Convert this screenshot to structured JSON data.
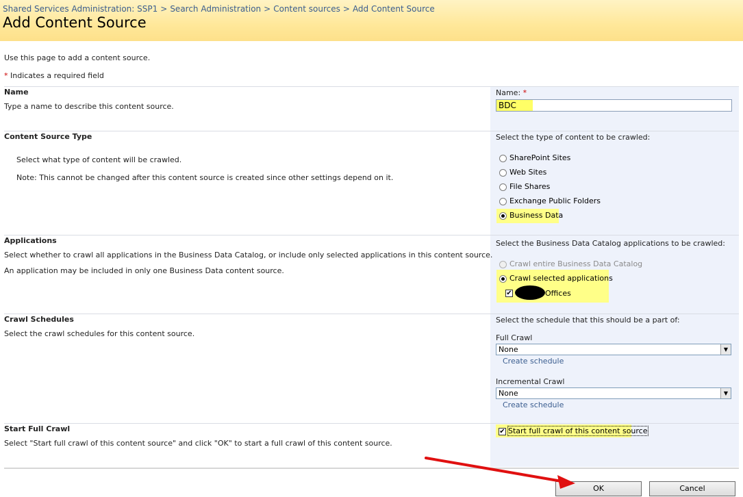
{
  "breadcrumb": {
    "items": [
      "Shared Services Administration: SSP1",
      "Search Administration",
      "Content sources",
      "Add Content Source"
    ],
    "separator": ">"
  },
  "page": {
    "title": "Add Content Source",
    "intro": "Use this page to add a content source.",
    "required_marker": "*",
    "required_text": "Indicates a required field"
  },
  "name_section": {
    "title": "Name",
    "description": "Type a name to describe this content source.",
    "field_label": "Name:",
    "field_required": "*",
    "value": "BDC"
  },
  "type_section": {
    "title": "Content Source Type",
    "description1": "Select what type of content will be crawled.",
    "description2": "Note: This cannot be changed after this content source is created since other settings depend on it.",
    "prompt": "Select the type of content to be crawled:",
    "options": [
      "SharePoint Sites",
      "Web Sites",
      "File Shares",
      "Exchange Public Folders",
      "Business Data"
    ],
    "selected": "Business Data"
  },
  "apps_section": {
    "title": "Applications",
    "description1": "Select whether to crawl all applications in the Business Data Catalog, or include only selected applications in this content source.",
    "description2": "An application may be included in only one Business Data content source.",
    "prompt": "Select the Business Data Catalog applications to be crawled:",
    "option_all": "Crawl entire Business Data Catalog",
    "option_selected": "Crawl selected applications",
    "app_item": "Offices",
    "app_checked": true
  },
  "schedule_section": {
    "title": "Crawl Schedules",
    "description": "Select the crawl schedules for this content source.",
    "prompt": "Select the schedule that this should be a part of:",
    "full_label": "Full Crawl",
    "full_value": "None",
    "full_link": "Create schedule",
    "incr_label": "Incremental Crawl",
    "incr_value": "None",
    "incr_link": "Create schedule"
  },
  "start_section": {
    "title": "Start Full Crawl",
    "description": "Select \"Start full crawl of this content source\" and click \"OK\" to start a full crawl of this content source.",
    "checkbox_label": "Start full crawl of this content source",
    "checked": true
  },
  "buttons": {
    "ok": "OK",
    "cancel": "Cancel"
  },
  "colors": {
    "header_bg": "#ffe89a",
    "link": "#3a5d8f",
    "highlight": "#ffff88",
    "right_panel": "#eef2fb",
    "arrow": "#e01010"
  }
}
